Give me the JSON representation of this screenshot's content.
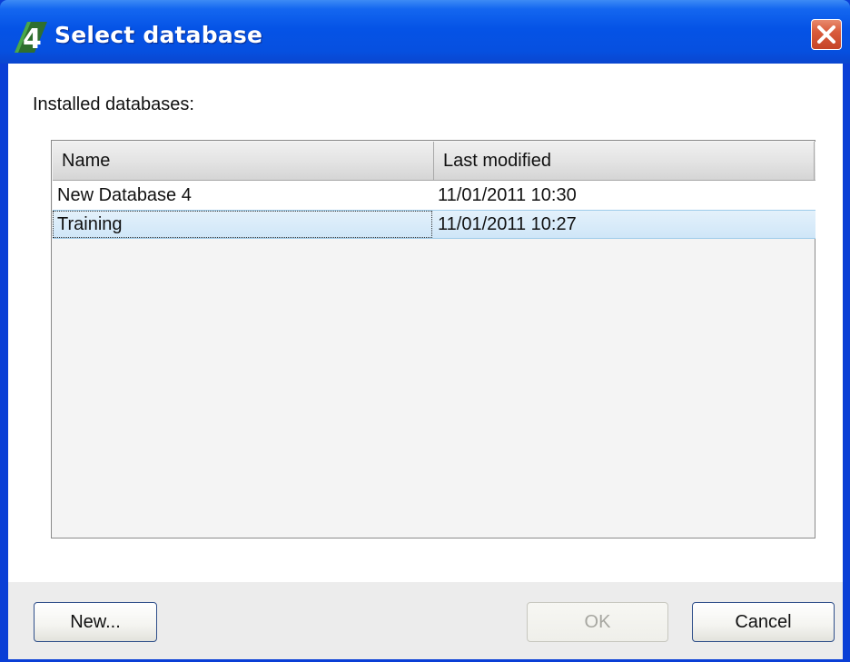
{
  "window": {
    "title": "Select database",
    "app_icon": "4d-app-icon",
    "close_icon": "close-icon"
  },
  "label": "Installed databases:",
  "list": {
    "columns": [
      "Name",
      "Last modified"
    ],
    "rows": [
      {
        "name": "New Database 4",
        "modified": "11/01/2011 10:30",
        "selected": false
      },
      {
        "name": "Training",
        "modified": "11/01/2011 10:27",
        "selected": true
      }
    ]
  },
  "buttons": {
    "new": "New...",
    "ok": "OK",
    "cancel": "Cancel"
  },
  "colors": {
    "titlebar": "#0553e6",
    "close_button": "#d95c3c",
    "selection": "#cfe6f8"
  }
}
